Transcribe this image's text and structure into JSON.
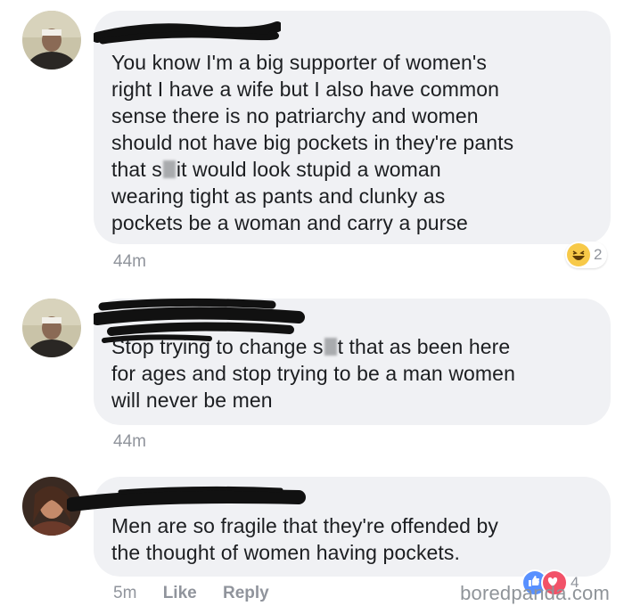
{
  "comments": [
    {
      "lines": [
        "You know I'm a big supporter of women's",
        "right I have a wife but I also have common",
        "sense there is no patriarchy and women",
        "should not have big pockets in they're pants",
        "that s",
        "it would look stupid a woman",
        "wearing tight as pants and clunky as",
        "pockets be a woman and carry a purse"
      ],
      "time": "44m",
      "reaction_count": "2",
      "reaction_icon": "haha-emoji-icon"
    },
    {
      "lines": [
        "Stop trying to change s",
        "t that as been here",
        "for ages and stop trying to be a man women",
        "will never be men"
      ],
      "time": "44m"
    },
    {
      "lines": [
        "Men are so fragile that they're offended by",
        "the thought of women having pockets."
      ],
      "time": "5m",
      "like_label": "Like",
      "reply_label": "Reply",
      "reaction_count": "4",
      "reaction_icons": [
        "like-icon",
        "love-icon"
      ]
    }
  ],
  "watermark": "boredpanda.com",
  "colors": {
    "bubble": "#f0f1f4",
    "text": "#1c1e21",
    "meta": "#90949c",
    "like_blue": "#5890ff",
    "love_red": "#f25268"
  }
}
